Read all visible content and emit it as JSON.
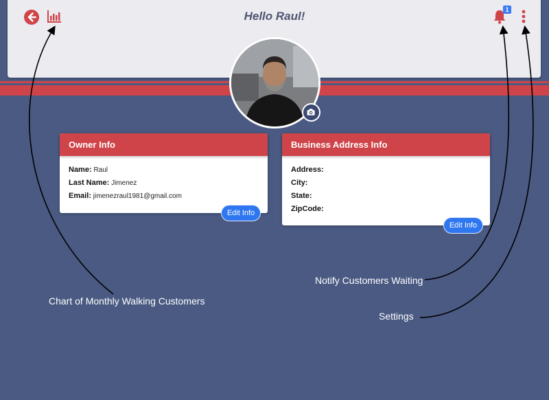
{
  "header": {
    "greeting": "Hello Raul!",
    "back_icon": "arrow-left-circle-icon",
    "chart_icon": "bar-chart-icon",
    "bell_icon": "bell-icon",
    "notification_count": "1",
    "menu_icon": "kebab-menu-icon"
  },
  "profile": {
    "avatar": "profile-photo",
    "camera_icon": "camera-icon"
  },
  "owner_card": {
    "title": "Owner Info",
    "name_label": "Name:",
    "name_value": "Raul",
    "last_name_label": "Last Name:",
    "last_name_value": "Jimenez",
    "email_label": "Email:",
    "email_value": "jimenezraul1981@gmail.com",
    "edit_label": "Edit Info"
  },
  "business_card": {
    "title": "Business Address Info",
    "address_label": "Address:",
    "city_label": "City:",
    "state_label": "State:",
    "zipcode_label": "ZipCode:",
    "edit_label": "Edit Info"
  },
  "annotations": {
    "chart": "Chart of Monthly Walking Customers",
    "notify": "Notify Customers Waiting",
    "settings": "Settings"
  },
  "colors": {
    "accent_red": "#cf4449",
    "background": "#4a5a82",
    "header_bg": "#ebebf0",
    "button_blue": "#2f77f0",
    "badge_blue": "#3b7bf3"
  }
}
